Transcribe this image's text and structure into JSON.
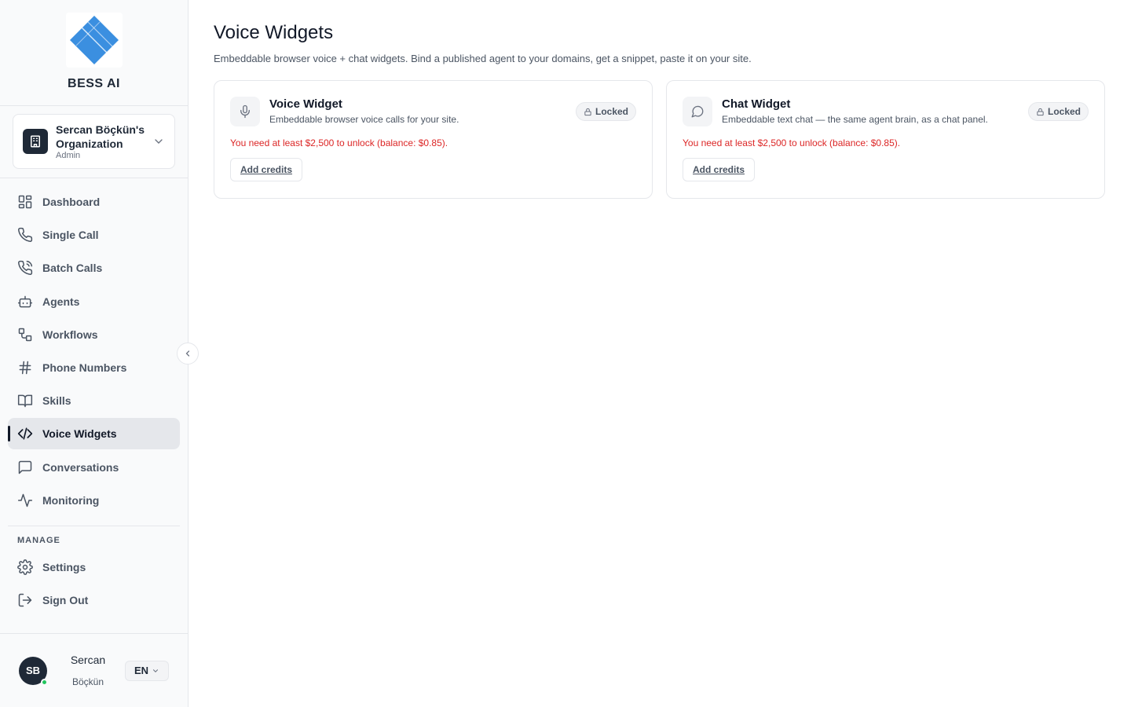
{
  "brand": {
    "name": "BESS AI",
    "logo_icon": "diamond-logo-icon"
  },
  "org": {
    "name": "Sercan Böçkün's Organization",
    "role": "Admin"
  },
  "nav": {
    "items": [
      {
        "label": "Dashboard",
        "icon": "dashboard-icon"
      },
      {
        "label": "Single Call",
        "icon": "phone-icon"
      },
      {
        "label": "Batch Calls",
        "icon": "phone-calls-icon"
      },
      {
        "label": "Agents",
        "icon": "bot-icon"
      },
      {
        "label": "Workflows",
        "icon": "workflow-icon"
      },
      {
        "label": "Phone Numbers",
        "icon": "hash-icon"
      },
      {
        "label": "Skills",
        "icon": "book-icon"
      },
      {
        "label": "Voice Widgets",
        "icon": "code-icon",
        "active": true
      },
      {
        "label": "Conversations",
        "icon": "message-square-icon"
      },
      {
        "label": "Monitoring",
        "icon": "activity-icon"
      }
    ],
    "manage_label": "MANAGE",
    "manage_items": [
      {
        "label": "Settings",
        "icon": "gear-icon"
      },
      {
        "label": "Sign Out",
        "icon": "sign-out-icon"
      }
    ]
  },
  "user": {
    "initials": "SB",
    "first_name": "Sercan",
    "last_name": "Böçkün",
    "language": "EN"
  },
  "page": {
    "title": "Voice Widgets",
    "subtitle": "Embeddable browser voice + chat widgets. Bind a published agent to your domains, get a snippet, paste it on your site."
  },
  "cards": [
    {
      "title": "Voice Widget",
      "description": "Embeddable browser voice calls for your site.",
      "badge": "Locked",
      "warning": "You need at least $2,500 to unlock (balance: $0.85).",
      "button": "Add credits",
      "icon": "microphone-icon"
    },
    {
      "title": "Chat Widget",
      "description": "Embeddable text chat — the same agent brain, as a chat panel.",
      "badge": "Locked",
      "warning": "You need at least $2,500 to unlock (balance: $0.85).",
      "button": "Add credits",
      "icon": "chat-bubble-icon"
    }
  ],
  "colors": {
    "accent": "#3b82f6",
    "danger": "#dc2626",
    "active_bg": "#e5e7eb"
  }
}
